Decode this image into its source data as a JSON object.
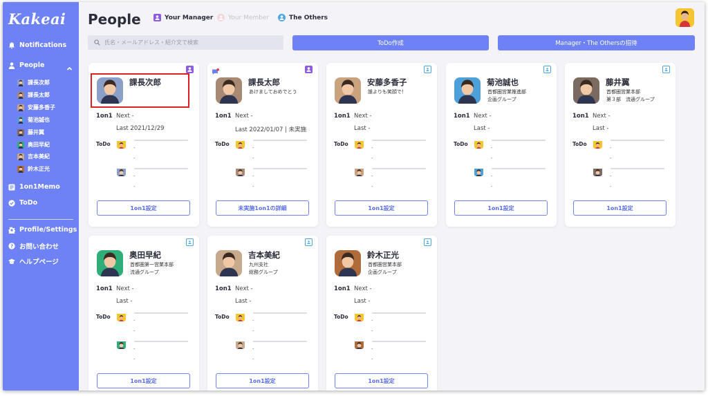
{
  "sidebar": {
    "logo": "Kakeai",
    "notifications": "Notifications",
    "people": "People",
    "members": [
      {
        "label": "課長次郎",
        "color": "#8aa0c8"
      },
      {
        "label": "課長太郎",
        "color": "#a88a74"
      },
      {
        "label": "安藤多香子",
        "color": "#c9a27e"
      },
      {
        "label": "菊池誠也",
        "color": "#4da0d8"
      },
      {
        "label": "藤井翼",
        "color": "#7a6a60"
      },
      {
        "label": "奥田早紀",
        "color": "#2fae7a"
      },
      {
        "label": "吉本美紀",
        "color": "#c7a98c"
      },
      {
        "label": "鈴木正光",
        "color": "#b06b3a"
      }
    ],
    "memo": "1on1Memo",
    "todo": "ToDo",
    "profile": "Profile/Settings",
    "contact": "お問い合わせ",
    "help": "ヘルプページ"
  },
  "header": {
    "title": "People",
    "filters": [
      "Your Manager",
      "Your Member",
      "The Others"
    ]
  },
  "search": {
    "placeholder": "氏名・メールアドレス・紹介文で検索"
  },
  "actions": {
    "todo_create": "ToDo作成",
    "invite": "Manager・The Othersの招待"
  },
  "labels": {
    "oneonone": "1on1",
    "next": "Next",
    "last": "Last",
    "todo": "ToDo",
    "dash": "-"
  },
  "colors": {
    "accent": "#6e82f5",
    "manager_badge": "#8c5be0",
    "other_badge": "#4da6e0",
    "highlight": "#e02020"
  },
  "cards": [
    {
      "name": "課長次郎",
      "sub1": "",
      "sub2": "",
      "role": "manager",
      "next": "Next -",
      "last": "Last  2021/12/29",
      "button": "1on1設定",
      "photo": "#8aa0c8"
    },
    {
      "name": "課長太郎",
      "sub1": "あけましておめでとう",
      "sub2": "",
      "role": "manager",
      "next": "Next -",
      "last": "Last  2022/01/07 | 未実施",
      "button": "未実施1on1の詳細",
      "photo": "#a88a74"
    },
    {
      "name": "安藤多香子",
      "sub1": "誰よりも笑顔で！",
      "sub2": "",
      "role": "other",
      "next": "Next -",
      "last": "Last -",
      "button": "1on1設定",
      "photo": "#c9a27e"
    },
    {
      "name": "菊池誠也",
      "sub1": "首都圏営業推進部",
      "sub2": "企画グループ",
      "role": "other",
      "next": "Next -",
      "last": "Last -",
      "button": "1on1設定",
      "photo": "#4da0d8"
    },
    {
      "name": "藤井翼",
      "sub1": "首都圏営業本部",
      "sub2": "第３部　流通グループ",
      "role": "other",
      "next": "Next -",
      "last": "Last -",
      "button": "1on1設定",
      "photo": "#7a6a60"
    },
    {
      "name": "奥田早紀",
      "sub1": "首都圏第一営業本部",
      "sub2": "流通グループ",
      "role": "other",
      "next": "Next -",
      "last": "Last -",
      "button": "1on1設定",
      "photo": "#2fae7a"
    },
    {
      "name": "吉本美紀",
      "sub1": "九州支社",
      "sub2": "総務グループ",
      "role": "other",
      "next": "Next -",
      "last": "Last -",
      "button": "1on1設定",
      "photo": "#c7a98c"
    },
    {
      "name": "鈴木正光",
      "sub1": "首都圏営業本部",
      "sub2": "企画グループ",
      "role": "other",
      "next": "Next -",
      "last": "Last -",
      "button": "1on1設定",
      "photo": "#b06b3a"
    }
  ]
}
